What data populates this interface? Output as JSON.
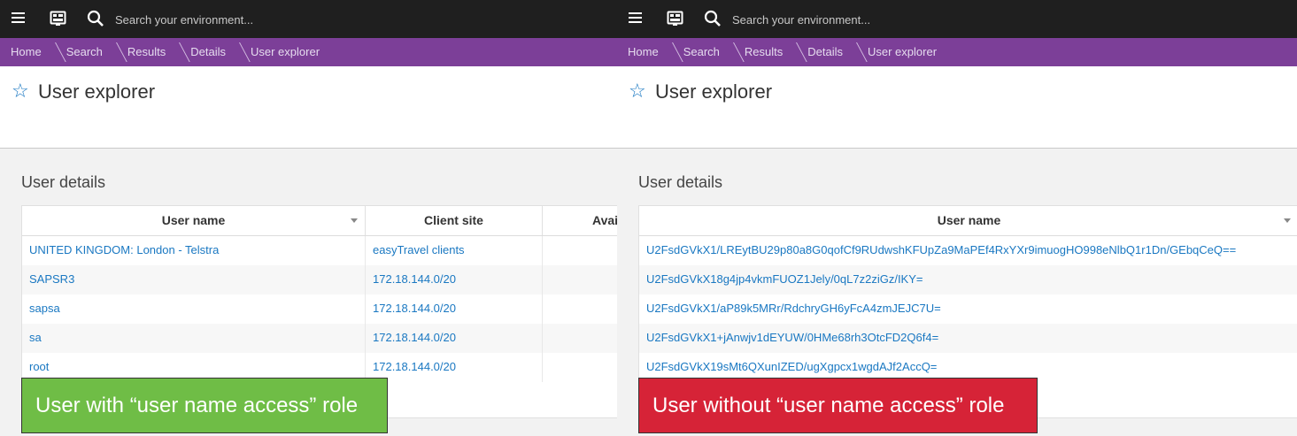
{
  "search": {
    "placeholder": "Search your environment..."
  },
  "breadcrumb": [
    "Home",
    "Search",
    "Results",
    "Details",
    "User explorer"
  ],
  "page_title": "User explorer",
  "section_title": "User details",
  "left_table": {
    "columns": [
      "User name",
      "Client site",
      "Avai"
    ],
    "rows": [
      [
        "UNITED KINGDOM: London - Telstra",
        "easyTravel clients"
      ],
      [
        "SAPSR3",
        "172.18.144.0/20"
      ],
      [
        "sapsa",
        "172.18.144.0/20"
      ],
      [
        "sa",
        "172.18.144.0/20"
      ],
      [
        "root",
        "172.18.144.0/20"
      ]
    ]
  },
  "right_table": {
    "columns": [
      "User name"
    ],
    "rows": [
      "U2FsdGVkX1/LREytBU29p80a8G0qofCf9RUdwshKFUpZa9MaPEf4RxYXr9imuogHO998eNlbQ1r1Dn/GEbqCeQ==",
      "U2FsdGVkX18g4jp4vkmFUOZ1Jely/0qL7z2ziGz/IKY=",
      "U2FsdGVkX1/aP89k5MRr/RdchryGH6yFcA4zmJEJC7U=",
      "U2FsdGVkX1+jAnwjv1dEYUW/0HMe68rh3OtcFD2Q6f4=",
      "U2FsdGVkX19sMt6QXunIZED/ugXgpcx1wgdAJf2AccQ="
    ]
  },
  "labels": {
    "with_role": "User with “user name access” role",
    "without_role": "User without “user name access” role"
  },
  "colors": {
    "topbar": "#1f1f1f",
    "breadcrumb": "#7c3f98",
    "link": "#1a78c2",
    "label_green": "#6fbd46",
    "label_red": "#d62337"
  },
  "icons": [
    "menu-icon",
    "dashboard-icon",
    "search-icon",
    "star-icon",
    "sort-arrow-icon"
  ]
}
